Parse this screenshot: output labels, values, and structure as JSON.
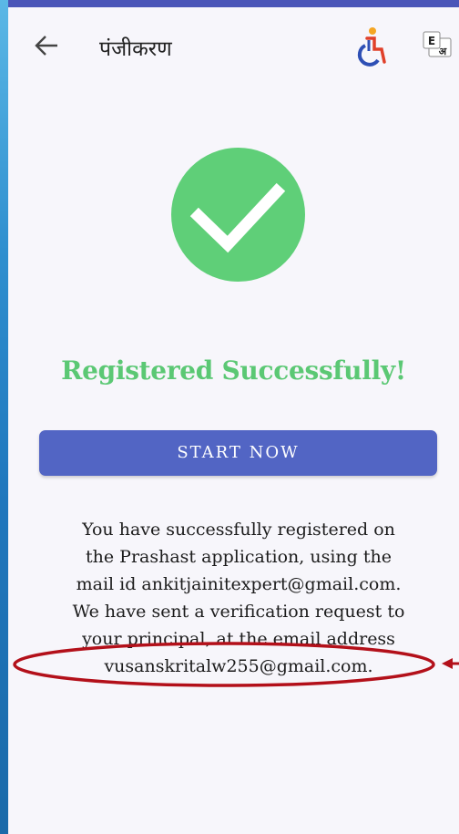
{
  "header": {
    "title": "पंजीकरण",
    "back_icon": "arrow-left-icon",
    "accessibility_icon": "accessibility-icon",
    "language_icon": "language-toggle-icon",
    "language_letters": [
      "E",
      "अ"
    ]
  },
  "success": {
    "icon": "check-circle-icon",
    "icon_color": "#5fcf78",
    "title": "Registered Successfully!",
    "title_color": "#5bc874"
  },
  "actions": {
    "start_label": "START NOW",
    "button_color": "#5265c4"
  },
  "message": {
    "lines": [
      "You have successfully registered on",
      "the Prashast application, using the",
      "mail id ankitjainitexpert@gmail.com.",
      "We have sent a verification request to",
      "your principal, at the email address",
      "vusanskritalw255@gmail.com."
    ]
  },
  "annotation": {
    "color": "#b3101a",
    "highlighted_text": "vusanskritalw255@gmail.com."
  }
}
